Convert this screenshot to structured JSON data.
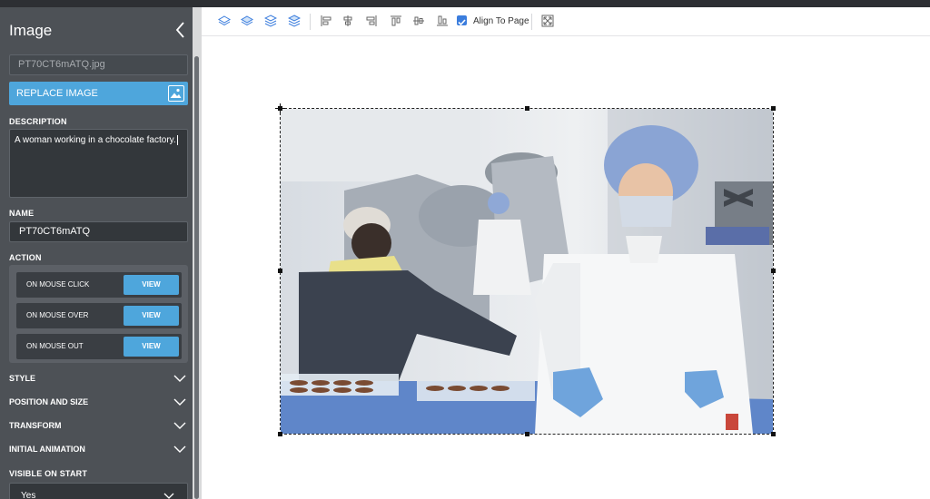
{
  "panel": {
    "title": "Image",
    "file_name": "PT70CT6mATQ.jpg",
    "replace_button": "REPLACE IMAGE",
    "description_label": "DESCRIPTION",
    "description_value": "A woman working in a chocolate factory.",
    "name_label": "NAME",
    "name_value": "PT70CT6mATQ",
    "action_label": "ACTION",
    "actions": [
      {
        "label": "ON MOUSE CLICK",
        "button": "VIEW"
      },
      {
        "label": "ON MOUSE OVER",
        "button": "VIEW"
      },
      {
        "label": "ON MOUSE OUT",
        "button": "VIEW"
      }
    ],
    "sections": [
      "STYLE",
      "POSITION AND SIZE",
      "TRANSFORM",
      "INITIAL ANIMATION"
    ],
    "visible_label": "VISIBLE ON START",
    "visible_value": "Yes"
  },
  "toolbar": {
    "icons": [
      "layer-bring-front-icon",
      "layer-bring-forward-icon",
      "layer-send-backward-icon",
      "layer-send-back-icon",
      "align-left-icon",
      "align-center-icon",
      "align-right-icon",
      "align-top-icon",
      "align-middle-icon",
      "align-bottom-icon",
      "fit-to-page-icon"
    ],
    "align_to_page_label": "Align To Page",
    "align_to_page_checked": true
  },
  "colors": {
    "sidebar": "#4d5156",
    "accent": "#4ea6dc",
    "field": "#33373b"
  }
}
